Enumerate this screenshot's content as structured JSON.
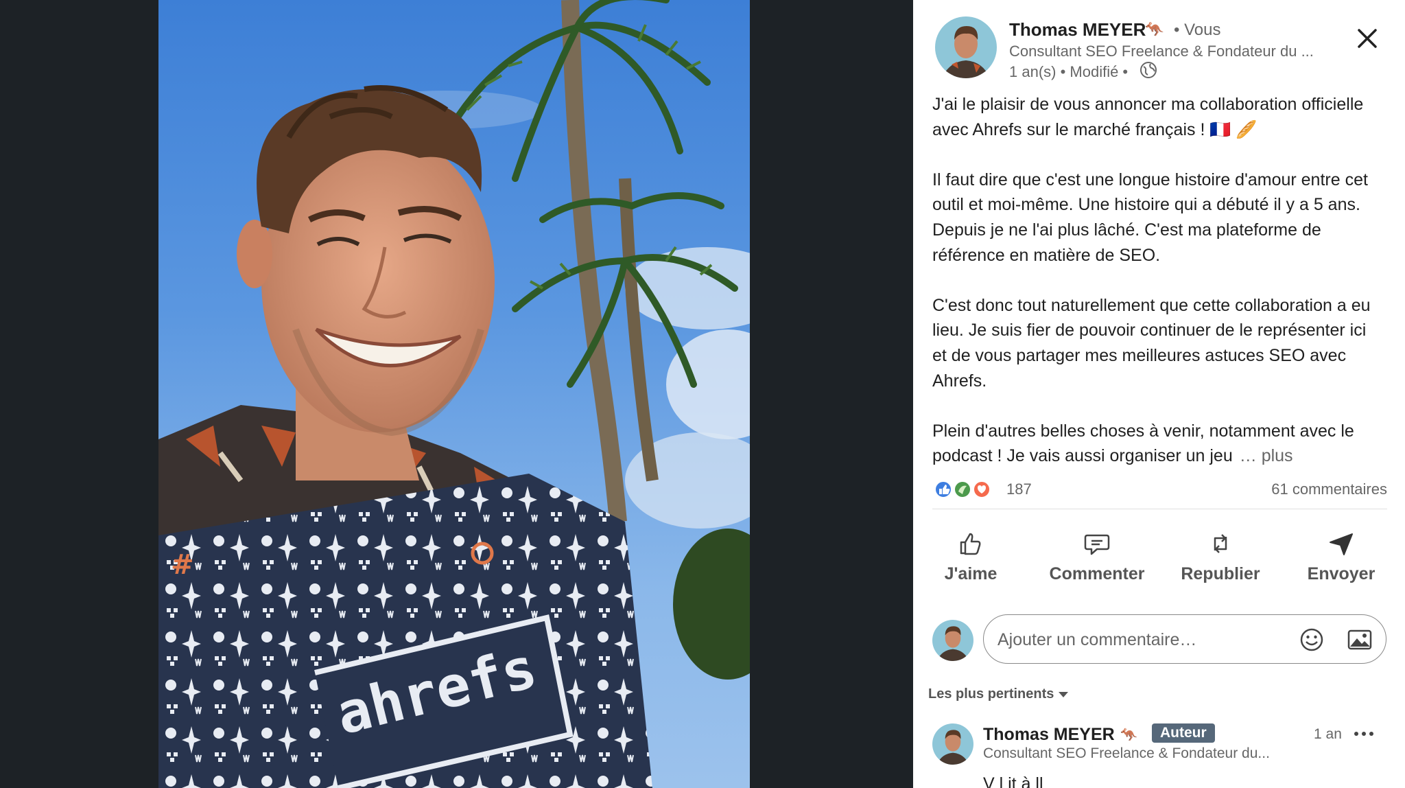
{
  "post": {
    "author": {
      "name": "Thomas MEYER",
      "emoji": "🦘",
      "relation": "• Vous",
      "headline": "Consultant SEO Freelance & Fondateur du ...",
      "time": "1 an(s) • Modifié •"
    },
    "paragraphs": [
      "J'ai le plaisir de vous annoncer ma collaboration officielle avec Ahrefs sur le marché français ! 🇫🇷 🥖",
      "Il faut dire que c'est une longue histoire d'amour entre cet outil et moi-même. Une histoire qui a débuté il y a 5 ans. Depuis je ne l'ai plus lâché. C'est ma plateforme de référence en matière de SEO.",
      "C'est donc tout naturellement que cette collaboration a eu lieu. Je suis fier de pouvoir continuer de le représenter ici et de vous partager mes meilleures astuces SEO avec Ahrefs."
    ],
    "last_paragraph": "Plein d'autres belles choses à venir, notamment avec le podcast ! Je vais aussi organiser un jeu",
    "see_more": "… plus",
    "reactions_count": "187",
    "comments_count": "61 commentaires",
    "photo_box_text": "ahrefs"
  },
  "actions": {
    "like": "J'aime",
    "comment": "Commenter",
    "repost": "Republier",
    "send": "Envoyer"
  },
  "composer": {
    "placeholder": "Ajouter un commentaire…"
  },
  "comments": {
    "sort_label": "Les plus pertinents",
    "first": {
      "name": "Thomas MEYER",
      "emoji": "🦘",
      "badge": "Auteur",
      "time": "1 an",
      "headline": "Consultant SEO Freelance & Fondateur du...",
      "preview": "V                                 l   it   à ll"
    }
  },
  "colors": {
    "page_bg": "#1d2226",
    "panel_bg": "#ffffff",
    "badge_bg": "#56687a",
    "muted_text": "#666666"
  }
}
